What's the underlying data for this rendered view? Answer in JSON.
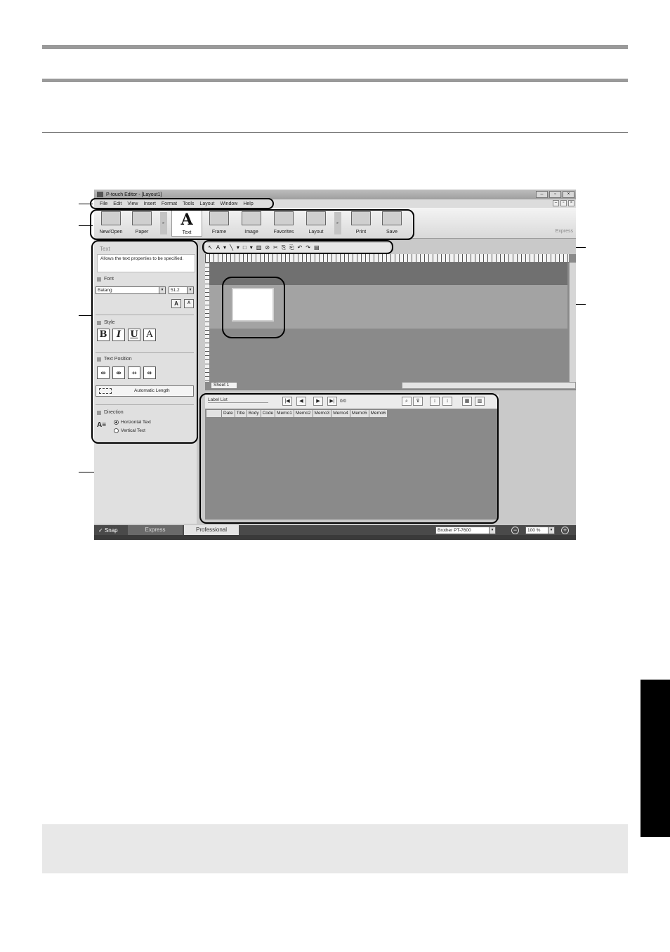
{
  "window": {
    "title": "P-touch Editor - [Layout1]",
    "controls": [
      "–",
      "▫",
      "×"
    ],
    "mdi_controls": [
      "–",
      "▫",
      "×"
    ]
  },
  "menu": [
    "File",
    "Edit",
    "View",
    "Insert",
    "Format",
    "Tools",
    "Layout",
    "Window",
    "Help"
  ],
  "ribbon": {
    "buttons": [
      "New/Open",
      "Paper",
      "Text",
      "Frame",
      "Image",
      "Favorites",
      "Layout",
      "Print",
      "Save"
    ],
    "text_glyph": "A",
    "mode_label": "Express"
  },
  "draw_toolbar": [
    "↖",
    "A",
    "▾",
    "╲",
    "▾",
    "□",
    "▾",
    "▥",
    "⊘",
    "✂",
    "⎘",
    "⎗",
    "↶",
    "↷",
    "▤"
  ],
  "properties": {
    "title": "Text",
    "description": "Allows the text properties to be specified.",
    "font_header": "Font",
    "font_name": "Batang",
    "font_size": "51.2",
    "size_up": "A",
    "size_down": "A",
    "style_header": "Style",
    "style_buttons": [
      "B",
      "I",
      "U",
      "A"
    ],
    "position_header": "Text Position",
    "position_buttons": [
      "⇹",
      "⇼",
      "⇸",
      "⇺"
    ],
    "auto_length": "Automatic Length",
    "direction_header": "Direction",
    "direction_icon": "A≡",
    "horizontal": "Horizontal Text",
    "vertical": "Vertical Text"
  },
  "layout": {
    "sheet_tab": "Sheet 1"
  },
  "database": {
    "title": "Label List",
    "nav": [
      "|◀",
      "◀",
      "▶",
      "▶|"
    ],
    "record_count": "0/0",
    "columns": [
      "",
      "Date",
      "Title",
      "Body",
      "Code",
      "Memo1",
      "Memo2",
      "Memo3",
      "Memo4",
      "Memo5",
      "Memo6"
    ]
  },
  "status": {
    "snap": "Snap",
    "express_tab": "Express",
    "professional_tab": "Professional",
    "printer": "Brother PT-7600",
    "zoom": "100 %"
  }
}
